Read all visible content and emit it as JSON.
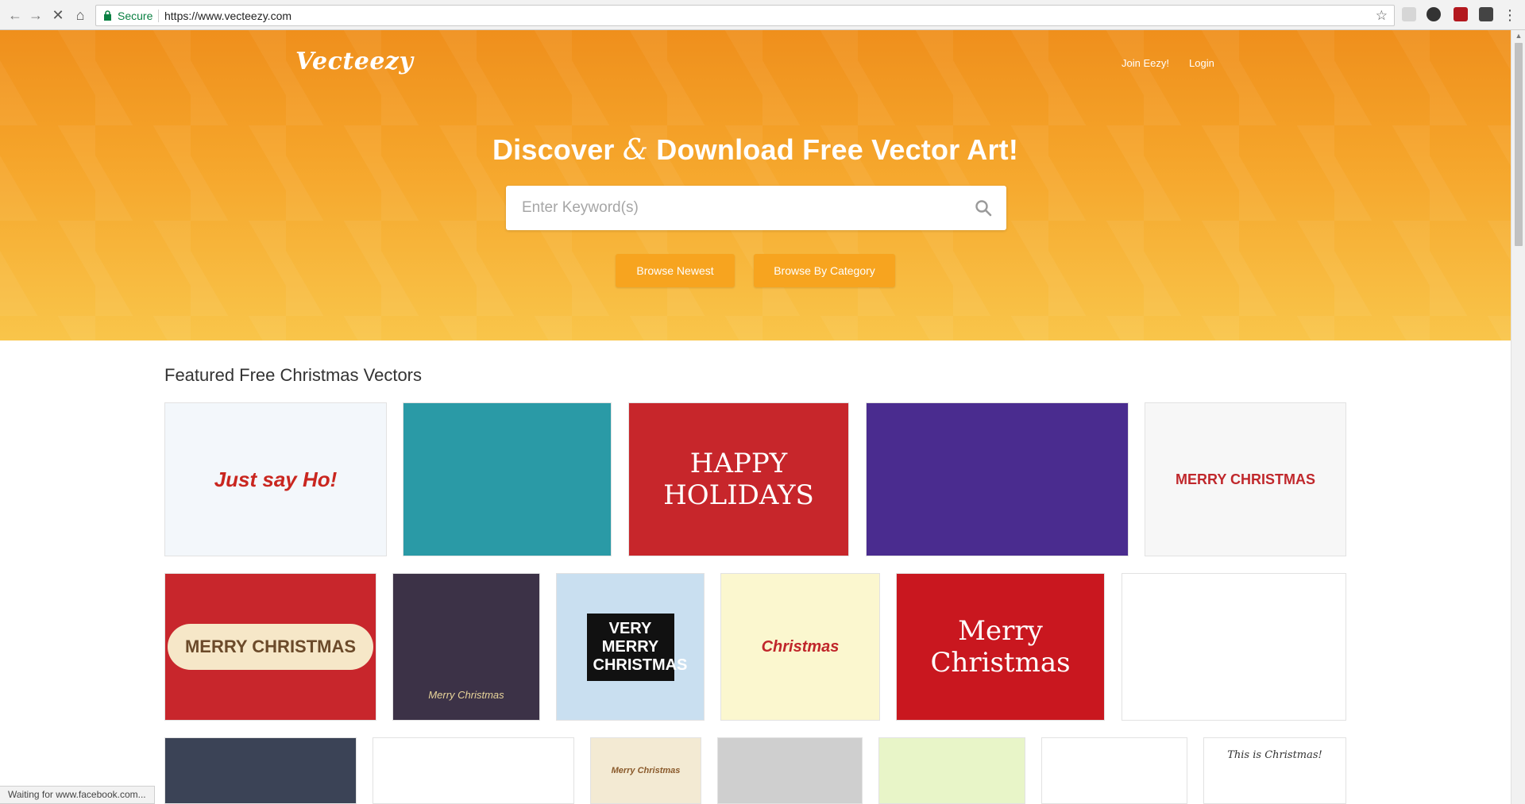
{
  "browser": {
    "secure_label": "Secure",
    "url": "https://www.vecteezy.com",
    "nav_icons": [
      "back-icon",
      "forward-icon",
      "stop-icon",
      "home-icon"
    ],
    "status_text": "Waiting for www.facebook.com..."
  },
  "header": {
    "logo": "Vecteezy",
    "nav": [
      "Join Eezy!",
      "Login"
    ]
  },
  "hero": {
    "headline_pre": "Discover ",
    "headline_amp": "&",
    "headline_post": " Download Free Vector Art!",
    "search_placeholder": "Enter Keyword(s)",
    "buttons": [
      "Browse Newest",
      "Browse By Category"
    ]
  },
  "featured": {
    "title": "Featured Free Christmas Vectors",
    "tiles": [
      {
        "text": "Just say Ho!",
        "bg": "#f3f7fb",
        "fg": "#c9261f"
      },
      {
        "text": "",
        "bg": "#2a9aa6",
        "fg": "#ffffff"
      },
      {
        "text": "HAPPY HOLIDAYS",
        "bg": "#c7262b",
        "fg": "#ffffff"
      },
      {
        "text": "",
        "bg": "#4a2c8f",
        "fg": "#ffffff"
      },
      {
        "text": "MERRY CHRISTMAS",
        "bg": "#f7f7f7",
        "fg": "#c0282c"
      },
      {
        "text": "MERRY CHRISTMAS",
        "bg": "#c8262c",
        "fg": "#6b4a2a"
      },
      {
        "text": "Merry Christmas",
        "bg": "#3c3247",
        "fg": "#e8d49a"
      },
      {
        "text": "VERY MERRY CHRISTMAS",
        "bg": "#c9dff0",
        "fg": "#222222"
      },
      {
        "text": "Christmas",
        "bg": "#fbf7cf",
        "fg": "#c0262b"
      },
      {
        "text": "Merry Christmas",
        "bg": "#c9171f",
        "fg": "#ffffff"
      },
      {
        "text": "",
        "bg": "#ffffff",
        "fg": "#2f7d3a"
      },
      {
        "text": "",
        "bg": "#3b4356",
        "fg": "#e7c45a"
      },
      {
        "text": "",
        "bg": "#ffffff",
        "fg": "#c9262c"
      },
      {
        "text": "Merry Christmas",
        "bg": "#f3ead3",
        "fg": "#8a5a2b"
      },
      {
        "text": "",
        "bg": "#cfcfcf",
        "fg": "#333333"
      },
      {
        "text": "",
        "bg": "#e8f5c8",
        "fg": "#3d7a3a"
      },
      {
        "text": "",
        "bg": "#ffffff",
        "fg": "#3c74a8"
      },
      {
        "text": "This is Christmas!",
        "bg": "#ffffff",
        "fg": "#333333"
      }
    ]
  },
  "colors": {
    "brand_orange": "#ef8f1c",
    "button_orange": "#f7a41f"
  }
}
